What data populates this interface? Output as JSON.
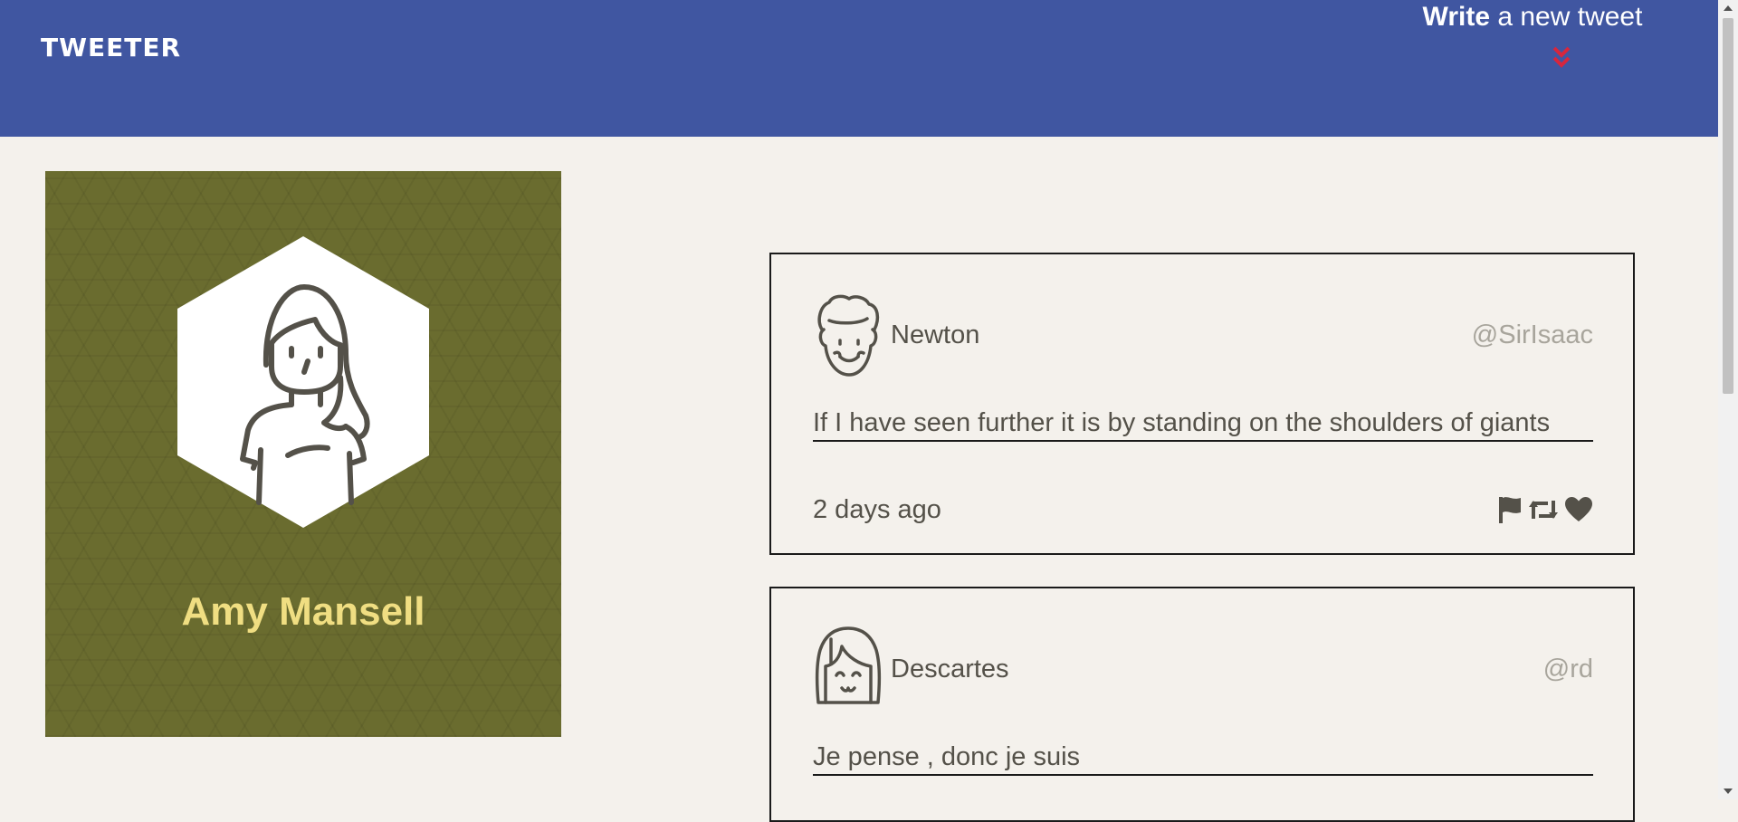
{
  "header": {
    "brand": "TWEETER",
    "compose_bold": "Write",
    "compose_rest": " a new tweet",
    "toggle_icon": "double-chevron-down-icon"
  },
  "profile": {
    "name": "Amy Mansell",
    "avatar_icon": "woman-avatar-icon"
  },
  "tweets": [
    {
      "name": "Newton",
      "handle": "@SirIsaac",
      "text": "If I have seen further it is by standing on the shoulders of giants",
      "time": "2 days ago",
      "avatar_icon": "curly-hair-man-avatar-icon",
      "actions": [
        "flag-icon",
        "retweet-icon",
        "heart-icon"
      ]
    },
    {
      "name": "Descartes",
      "handle": "@rd",
      "text": "Je pense , donc je suis",
      "avatar_icon": "bob-hair-avatar-icon"
    }
  ],
  "colors": {
    "header_bg": "#4056a1",
    "page_bg": "#f4f1ec",
    "profile_bg": "#6a6c2f",
    "profile_name": "#f0de82",
    "accent_red": "#d7263d",
    "text": "#545149",
    "handle": "#a8a59c"
  }
}
